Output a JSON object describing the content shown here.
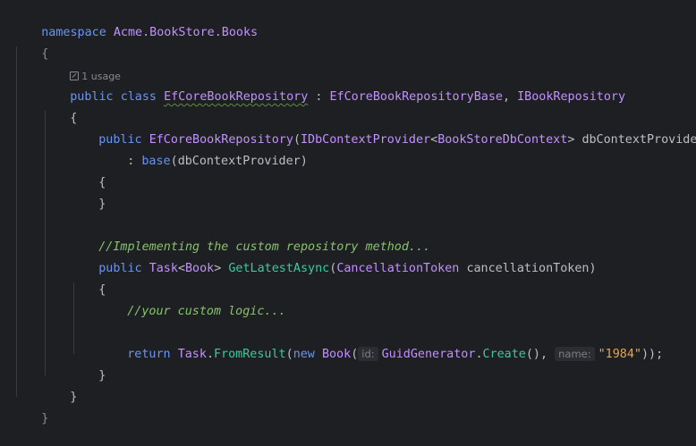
{
  "code": {
    "ns_kw": "namespace",
    "ns_name": "Acme.BookStore.Books",
    "open_brace": "{",
    "close_brace": "}",
    "usage_label": "1 usage",
    "kw_public": "public",
    "kw_class": "class",
    "class_name": "EfCoreBookRepository",
    "colon": " : ",
    "base_class": "EfCoreBookRepositoryBase",
    "comma": ", ",
    "interface": "IBookRepository",
    "ctor_name": "EfCoreBookRepository",
    "paren_open": "(",
    "param_type_outer": "IDbContextProvider",
    "lt": "<",
    "param_type_inner": "BookStoreDbContext",
    "gt_space": "> ",
    "param_name": "dbContextProvider",
    "paren_close": ")",
    "base_colon": ": ",
    "kw_base": "base",
    "base_arg": "dbContextProvider",
    "comment_impl": "//Implementing the custom repository method...",
    "ret_task": "Task",
    "ret_book": "Book",
    "method_name": "GetLatestAsync",
    "token_type": "CancellationToken",
    "token_name": "cancellationToken",
    "comment_logic": "//your custom logic...",
    "kw_return": "return",
    "task_cls": "Task",
    "dot": ".",
    "from_result": "FromResult",
    "kw_new": "new",
    "book_cls": "Book",
    "hint_id": "id:",
    "guid_gen": "GuidGenerator",
    "create_fn": "Create",
    "empty_parens": "()",
    "hint_name": "name:",
    "string_val": "\"1984\"",
    "tail": "));"
  }
}
